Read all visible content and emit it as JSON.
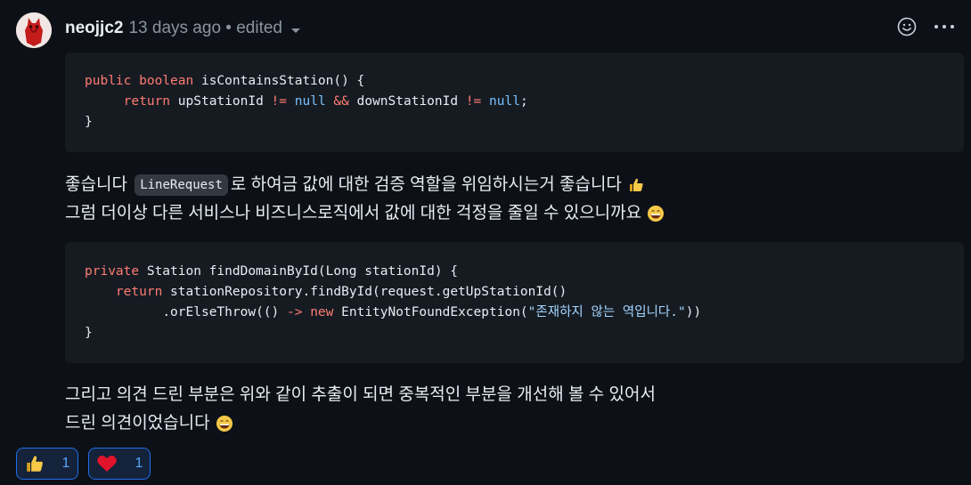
{
  "comment": {
    "author": "neojjc2",
    "meta": "13 days ago • edited"
  },
  "top_actions": {
    "emoji_icon": "smiley-icon",
    "more_icon": "kebab-horizontal-icon"
  },
  "code1": {
    "line1": {
      "kw1": "public",
      "kw2": "boolean",
      "rest": " isContainsStation() {"
    },
    "line2": {
      "kw_return": "return",
      "a": " upStationId ",
      "op1": "!=",
      "null1": "null",
      "and": "&&",
      "b": " downStationId ",
      "op2": "!=",
      "null2": "null",
      "end": ";"
    },
    "line3": "}"
  },
  "para1": {
    "line1_before": "좋습니다 ",
    "inline_code": "LineRequest",
    "line1_after": "로 하여금 값에 대한 검증 역할을 위임하시는거 좋습니다",
    "line2": "그럼 더이상 다른 서비스나 비즈니스로직에서 값에 대한 걱정을 줄일 수 있으니까요"
  },
  "code2": {
    "line1": {
      "kw": "private",
      "rest": " Station findDomainById(Long stationId) {"
    },
    "line2": {
      "kw": "return",
      "rest": " stationRepository.findById(request.getUpStationId()"
    },
    "line3": {
      "a": ".orElseThrow(() ",
      "arrow": "->",
      "new": "new",
      "b": " EntityNotFoundException(",
      "str": "\"존재하지 않는 역입니다.\"",
      "c": "))"
    },
    "line4": "}"
  },
  "para2": {
    "line1": "그리고 의견 드린 부분은 위와 같이 추출이 되면 중복적인 부분을 개선해 볼 수 있어서",
    "line2": "드린 의견이었습니다"
  },
  "reactions": [
    {
      "icon": "thumbs-up-icon",
      "count": "1"
    },
    {
      "icon": "heart-icon",
      "count": "1"
    }
  ],
  "colors": {
    "background": "#0d1117",
    "code_bg": "#161b22",
    "keyword": "#ff7b72",
    "literal": "#79c0ff",
    "string": "#a5d6ff",
    "accent": "#58a6ff"
  }
}
